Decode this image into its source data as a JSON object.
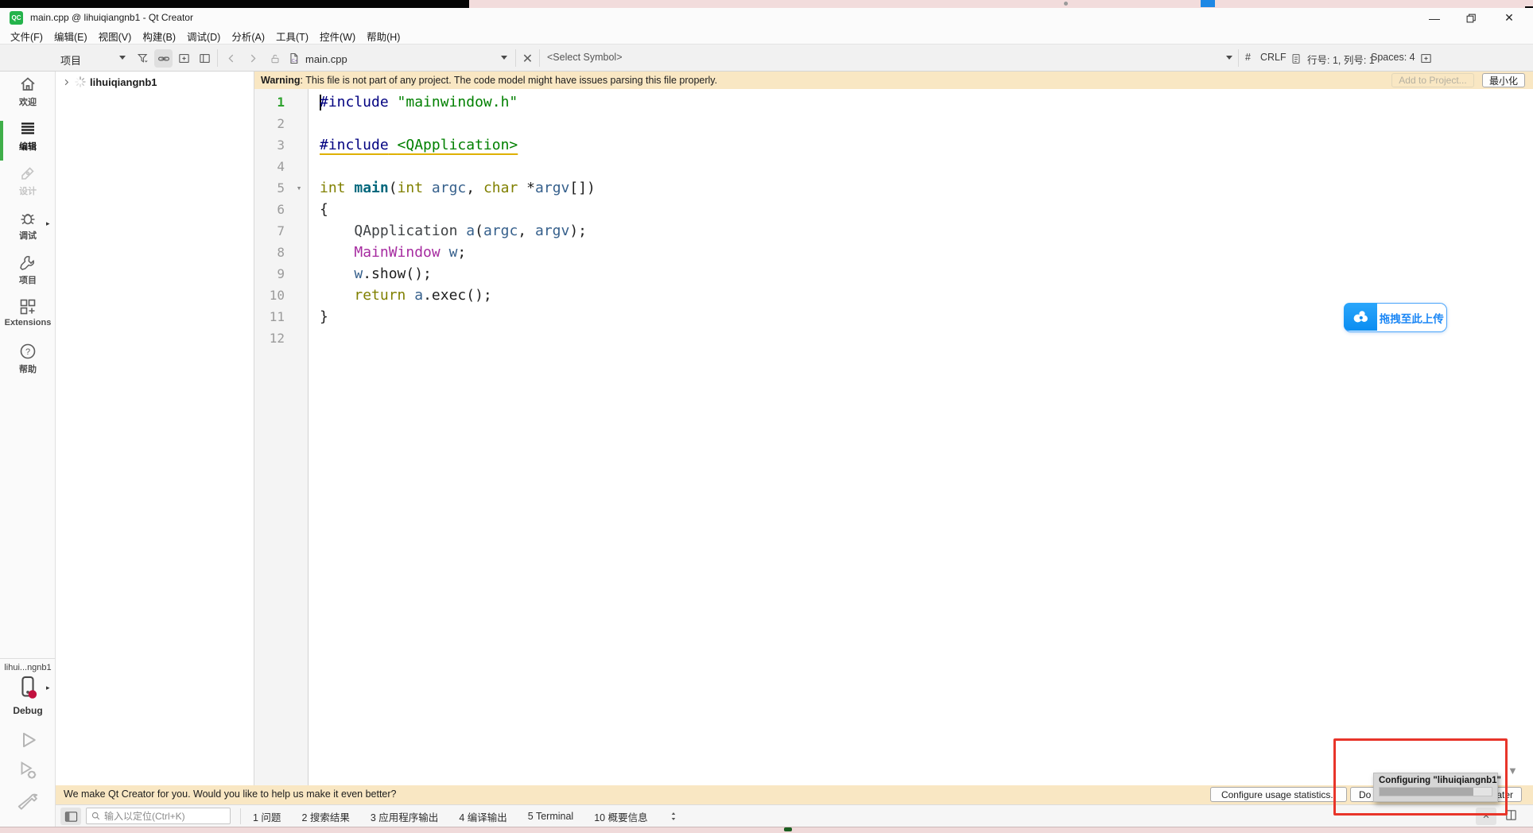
{
  "window": {
    "app_badge": "QC",
    "title": "main.cpp @ lihuiqiangnb1 - Qt Creator"
  },
  "menubar": {
    "items": [
      "文件(F)",
      "编辑(E)",
      "视图(V)",
      "构建(B)",
      "调试(D)",
      "分析(A)",
      "工具(T)",
      "控件(W)",
      "帮助(H)"
    ]
  },
  "toolbar": {
    "project_combo": "项目",
    "file_name": "main.cpp",
    "symbol_combo": "<Select Symbol>",
    "hash": "#",
    "line_ending": "CRLF",
    "cursor_position": "行号: 1, 列号: 1",
    "spaces": "Spaces: 4"
  },
  "warning_bar": {
    "label": "Warning",
    "message": ": This file is not part of any project. The code model might have issues parsing this file properly.",
    "add_to_project": "Add to Project...",
    "minimize": "最小化"
  },
  "sidebar": {
    "modes": [
      {
        "label": "欢迎"
      },
      {
        "label": "编辑"
      },
      {
        "label": "设计"
      },
      {
        "label": "调试"
      },
      {
        "label": "项目"
      },
      {
        "label": "Extensions"
      },
      {
        "label": "帮助"
      }
    ],
    "kit": {
      "project": "lihui...ngnb1",
      "build_config": "Debug"
    }
  },
  "project_tree": {
    "root": "lihuiqiangnb1"
  },
  "editor": {
    "lines": [
      {
        "num": "1",
        "current": true,
        "caret": true,
        "tokens": [
          {
            "c": "pre",
            "t": "#include"
          },
          {
            "c": "pl",
            "t": " "
          },
          {
            "c": "str",
            "t": "\"mainwindow.h\""
          }
        ]
      },
      {
        "num": "2",
        "tokens": []
      },
      {
        "num": "3",
        "tokens": [
          {
            "c": "pre u",
            "t": "#include"
          },
          {
            "c": "pl u",
            "t": " "
          },
          {
            "c": "str u",
            "t": "<QApplication>"
          }
        ]
      },
      {
        "num": "4",
        "tokens": []
      },
      {
        "num": "5",
        "fold": true,
        "tokens": [
          {
            "c": "kw",
            "t": "int"
          },
          {
            "c": "pl",
            "t": " "
          },
          {
            "c": "fn",
            "t": "main"
          },
          {
            "c": "pl",
            "t": "("
          },
          {
            "c": "kw",
            "t": "int"
          },
          {
            "c": "pl",
            "t": " "
          },
          {
            "c": "var",
            "t": "argc"
          },
          {
            "c": "pl",
            "t": ", "
          },
          {
            "c": "kw",
            "t": "char"
          },
          {
            "c": "pl",
            "t": " *"
          },
          {
            "c": "var",
            "t": "argv"
          },
          {
            "c": "pl",
            "t": "[])"
          }
        ]
      },
      {
        "num": "6",
        "tokens": [
          {
            "c": "pl",
            "t": "{"
          }
        ]
      },
      {
        "num": "7",
        "tokens": [
          {
            "c": "pl",
            "t": "    "
          },
          {
            "c": "typ",
            "t": "QApplication"
          },
          {
            "c": "pl",
            "t": " "
          },
          {
            "c": "var",
            "t": "a"
          },
          {
            "c": "pl",
            "t": "("
          },
          {
            "c": "var",
            "t": "argc"
          },
          {
            "c": "pl",
            "t": ", "
          },
          {
            "c": "var",
            "t": "argv"
          },
          {
            "c": "pl",
            "t": ");"
          }
        ]
      },
      {
        "num": "8",
        "tokens": [
          {
            "c": "pl",
            "t": "    "
          },
          {
            "c": "typm",
            "t": "MainWindow"
          },
          {
            "c": "pl",
            "t": " "
          },
          {
            "c": "var",
            "t": "w"
          },
          {
            "c": "pl",
            "t": ";"
          }
        ]
      },
      {
        "num": "9",
        "tokens": [
          {
            "c": "pl",
            "t": "    "
          },
          {
            "c": "var",
            "t": "w"
          },
          {
            "c": "pl",
            "t": ".show();"
          }
        ]
      },
      {
        "num": "10",
        "tokens": [
          {
            "c": "pl",
            "t": "    "
          },
          {
            "c": "kw",
            "t": "return"
          },
          {
            "c": "pl",
            "t": " "
          },
          {
            "c": "var",
            "t": "a"
          },
          {
            "c": "pl",
            "t": ".exec();"
          }
        ]
      },
      {
        "num": "11",
        "tokens": [
          {
            "c": "pl",
            "t": "}"
          }
        ]
      },
      {
        "num": "12",
        "tokens": []
      }
    ]
  },
  "upload_widget": {
    "label": "拖拽至此上传"
  },
  "overlay": {
    "tooltip_title": "Configuring \"lihuiqiangnb1\"",
    "progress_percent": 84
  },
  "info_bar": {
    "message": "We make Qt Creator for you. Would you like to help us make it even better?",
    "configure_button": "Configure usage statistics..",
    "do_button_left": "Do",
    "do_button_right": "later"
  },
  "status_bar": {
    "search_placeholder": "输入以定位(Ctrl+K)",
    "panes": [
      "1 问题",
      "2 搜索结果",
      "3 应用程序输出",
      "4 编译输出",
      "5 Terminal",
      "10 概要信息"
    ]
  }
}
